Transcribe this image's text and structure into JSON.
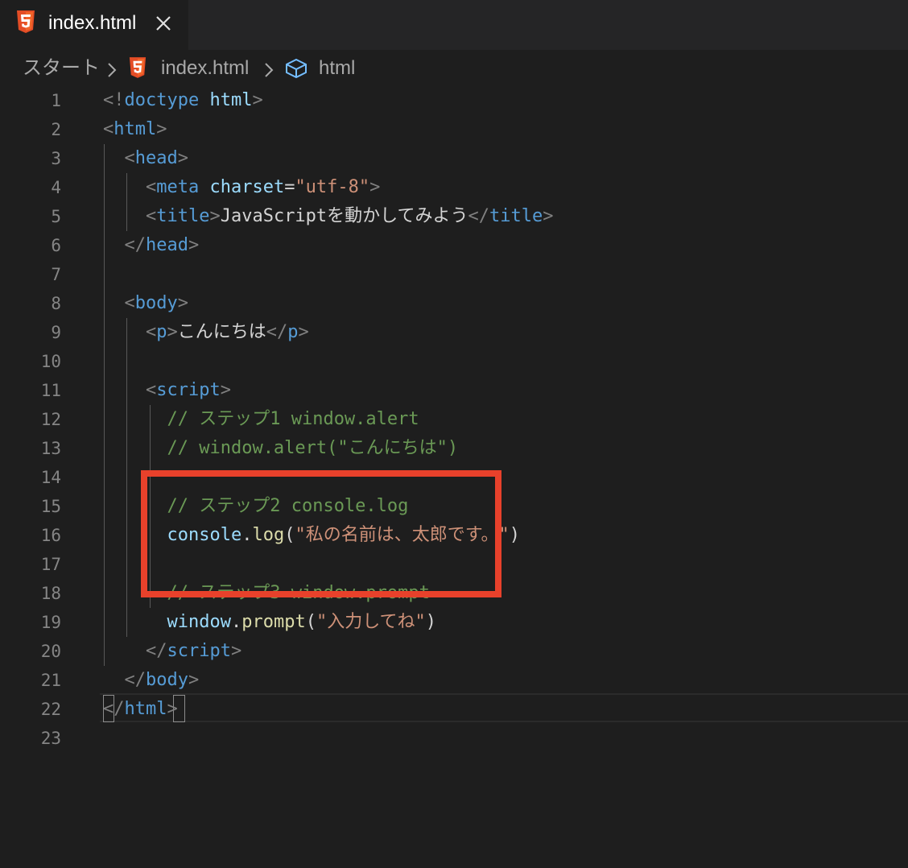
{
  "colors": {
    "accent_highlight": "#e8412b",
    "tag": "#569cd6",
    "attribute": "#9cdcfe",
    "string": "#ce9178",
    "comment": "#6a9955",
    "function": "#dcdcaa",
    "background": "#1e1e1e"
  },
  "tab": {
    "icon": "html5-icon",
    "label": "index.html",
    "close_icon": "close-icon"
  },
  "breadcrumb": {
    "items": [
      "スタート",
      "index.html",
      "html"
    ],
    "icons": [
      "chevron-right-icon",
      "html5-icon",
      "chevron-right-icon",
      "cube-icon"
    ]
  },
  "editor": {
    "line_numbers": [
      "1",
      "2",
      "3",
      "4",
      "5",
      "6",
      "7",
      "8",
      "9",
      "10",
      "11",
      "12",
      "13",
      "14",
      "15",
      "16",
      "17",
      "18",
      "19",
      "20",
      "21",
      "22",
      "23"
    ],
    "lines": [
      [
        {
          "t": "br",
          "v": "<!"
        },
        {
          "t": "tag",
          "v": "doctype"
        },
        {
          "t": "txt",
          "v": " "
        },
        {
          "t": "att",
          "v": "html"
        },
        {
          "t": "br",
          "v": ">"
        }
      ],
      [
        {
          "t": "br",
          "v": "<"
        },
        {
          "t": "tag",
          "v": "html"
        },
        {
          "t": "br",
          "v": ">"
        }
      ],
      [
        {
          "t": "txt",
          "v": "  "
        },
        {
          "t": "br",
          "v": "<"
        },
        {
          "t": "tag",
          "v": "head"
        },
        {
          "t": "br",
          "v": ">"
        }
      ],
      [
        {
          "t": "txt",
          "v": "    "
        },
        {
          "t": "br",
          "v": "<"
        },
        {
          "t": "tag",
          "v": "meta"
        },
        {
          "t": "txt",
          "v": " "
        },
        {
          "t": "att",
          "v": "charset"
        },
        {
          "t": "txt",
          "v": "="
        },
        {
          "t": "str",
          "v": "\"utf-8\""
        },
        {
          "t": "br",
          "v": ">"
        }
      ],
      [
        {
          "t": "txt",
          "v": "    "
        },
        {
          "t": "br",
          "v": "<"
        },
        {
          "t": "tag",
          "v": "title"
        },
        {
          "t": "br",
          "v": ">"
        },
        {
          "t": "txt",
          "v": "JavaScriptを動かしてみよう"
        },
        {
          "t": "br",
          "v": "</"
        },
        {
          "t": "tag",
          "v": "title"
        },
        {
          "t": "br",
          "v": ">"
        }
      ],
      [
        {
          "t": "txt",
          "v": "  "
        },
        {
          "t": "br",
          "v": "</"
        },
        {
          "t": "tag",
          "v": "head"
        },
        {
          "t": "br",
          "v": ">"
        }
      ],
      [],
      [
        {
          "t": "txt",
          "v": "  "
        },
        {
          "t": "br",
          "v": "<"
        },
        {
          "t": "tag",
          "v": "body"
        },
        {
          "t": "br",
          "v": ">"
        }
      ],
      [
        {
          "t": "txt",
          "v": "    "
        },
        {
          "t": "br",
          "v": "<"
        },
        {
          "t": "tag",
          "v": "p"
        },
        {
          "t": "br",
          "v": ">"
        },
        {
          "t": "txt",
          "v": "こんにちは"
        },
        {
          "t": "br",
          "v": "</"
        },
        {
          "t": "tag",
          "v": "p"
        },
        {
          "t": "br",
          "v": ">"
        }
      ],
      [],
      [
        {
          "t": "txt",
          "v": "    "
        },
        {
          "t": "br",
          "v": "<"
        },
        {
          "t": "tag",
          "v": "script"
        },
        {
          "t": "br",
          "v": ">"
        }
      ],
      [
        {
          "t": "txt",
          "v": "      "
        },
        {
          "t": "com",
          "v": "// ステップ1 window.alert"
        }
      ],
      [
        {
          "t": "txt",
          "v": "      "
        },
        {
          "t": "com",
          "v": "// window.alert(\"こんにちは\")"
        }
      ],
      [],
      [
        {
          "t": "txt",
          "v": "      "
        },
        {
          "t": "com",
          "v": "// ステップ2 console.log"
        }
      ],
      [
        {
          "t": "txt",
          "v": "      "
        },
        {
          "t": "var",
          "v": "console"
        },
        {
          "t": "txt",
          "v": "."
        },
        {
          "t": "fn",
          "v": "log"
        },
        {
          "t": "txt",
          "v": "("
        },
        {
          "t": "str",
          "v": "\"私の名前は、太郎です。\""
        },
        {
          "t": "txt",
          "v": ")"
        }
      ],
      [],
      [
        {
          "t": "txt",
          "v": "      "
        },
        {
          "t": "com",
          "v": "// ステップ3 window.prompt"
        }
      ],
      [
        {
          "t": "txt",
          "v": "      "
        },
        {
          "t": "var",
          "v": "window"
        },
        {
          "t": "txt",
          "v": "."
        },
        {
          "t": "fn",
          "v": "prompt"
        },
        {
          "t": "txt",
          "v": "("
        },
        {
          "t": "str",
          "v": "\"入力してね\""
        },
        {
          "t": "txt",
          "v": ")"
        }
      ],
      [
        {
          "t": "txt",
          "v": "    "
        },
        {
          "t": "br",
          "v": "</"
        },
        {
          "t": "tag",
          "v": "script"
        },
        {
          "t": "br",
          "v": ">"
        }
      ],
      [
        {
          "t": "txt",
          "v": "  "
        },
        {
          "t": "br",
          "v": "</"
        },
        {
          "t": "tag",
          "v": "body"
        },
        {
          "t": "br",
          "v": ">"
        }
      ],
      [
        {
          "t": "br",
          "v": "</"
        },
        {
          "t": "tag",
          "v": "html"
        },
        {
          "t": "br",
          "v": ">"
        }
      ],
      []
    ]
  }
}
